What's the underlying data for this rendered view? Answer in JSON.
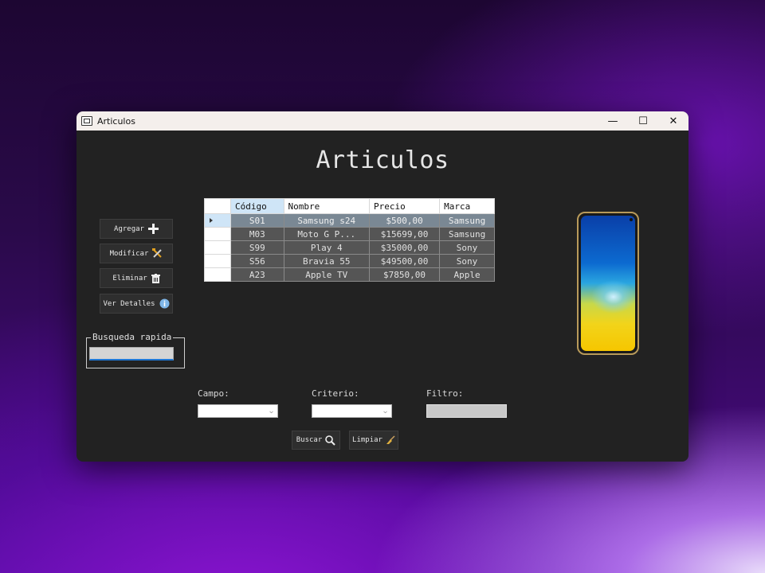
{
  "window": {
    "title": "Articulos",
    "controls": {
      "minimize": "—",
      "maximize": "☐",
      "close": "✕"
    }
  },
  "form": {
    "heading": "Articulos"
  },
  "sidebar": {
    "buttons": [
      {
        "label": "Agregar",
        "icon": "plus-icon"
      },
      {
        "label": "Modificar",
        "icon": "tools-icon"
      },
      {
        "label": "Eliminar",
        "icon": "trash-icon"
      },
      {
        "label": "Ver Detalles",
        "icon": "info-icon"
      }
    ]
  },
  "grid": {
    "columns": [
      "Código",
      "Nombre",
      "Precio",
      "Marca"
    ],
    "selected_row": 0,
    "rows": [
      [
        "S01",
        "Samsung s24",
        "$500,00",
        "Samsung"
      ],
      [
        "M03",
        "Moto G P...",
        "$15699,00",
        "Samsung"
      ],
      [
        "S99",
        "Play 4",
        "$35000,00",
        "Sony"
      ],
      [
        "S56",
        "Bravia 55",
        "$49500,00",
        "Sony"
      ],
      [
        "A23",
        "Apple TV",
        "$7850,00",
        "Apple"
      ]
    ]
  },
  "quick_search": {
    "legend": "Busqueda rapida",
    "value": ""
  },
  "filters": {
    "campo_label": "Campo:",
    "campo_value": "",
    "criterio_label": "Criterio:",
    "criterio_value": "",
    "filtro_label": "Filtro:",
    "filtro_value": ""
  },
  "actions": {
    "buscar": "Buscar",
    "limpiar": "Limpiar"
  },
  "colors": {
    "window_bg": "#222222",
    "selection": "#cfe5f7",
    "accent": "#1e78d6"
  }
}
